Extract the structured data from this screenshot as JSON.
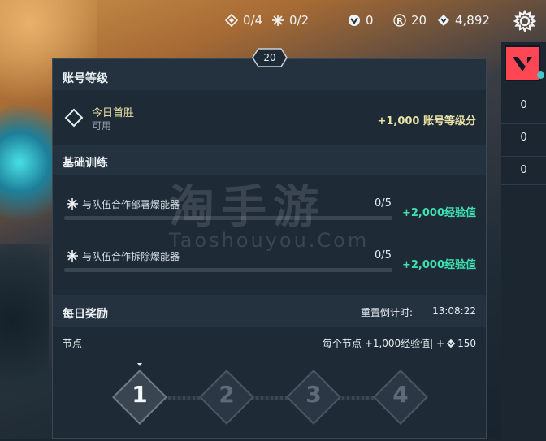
{
  "currencies": {
    "kingdom_credits": "0/4",
    "radianite_fragments": "0/2",
    "free_agents": "0",
    "radianite_points": "20",
    "valorant_points": "4,892"
  },
  "icons": {
    "settings": "gear-icon",
    "brand": "valorant-logo-icon"
  },
  "side_panel": {
    "counts": [
      "0",
      "0",
      "0"
    ]
  },
  "panel": {
    "level_badge": "20",
    "account_level": {
      "heading": "账号等级",
      "first_win_title": "今日首胜",
      "first_win_status": "可用",
      "first_win_reward": "+1,000 账号等级分"
    },
    "basic_training": {
      "heading": "基础训练",
      "tasks": [
        {
          "label": "与队伍合作部署爆能器",
          "progress": "0/5",
          "progress_value": 0,
          "reward": "+2,000经验值"
        },
        {
          "label": "与队伍合作拆除爆能器",
          "progress": "0/5",
          "progress_value": 0,
          "reward": "+2,000经验值"
        }
      ]
    },
    "daily_rewards": {
      "heading": "每日奖励",
      "reset_label": "重置倒计时:",
      "reset_time": "13:08:22",
      "nodes_label": "节点",
      "per_node_text": "每个节点 +1,000经验值| +",
      "per_node_vp": "150",
      "nodes": [
        "1",
        "2",
        "3",
        "4"
      ],
      "active_node": "1"
    }
  },
  "watermark": {
    "text": "淘手游",
    "subtext": "Taoshouyou.Com"
  },
  "colors": {
    "accent_green": "#3ee0b0",
    "reward_yellow": "#e9e2a6",
    "brand_red": "#ff4655"
  }
}
